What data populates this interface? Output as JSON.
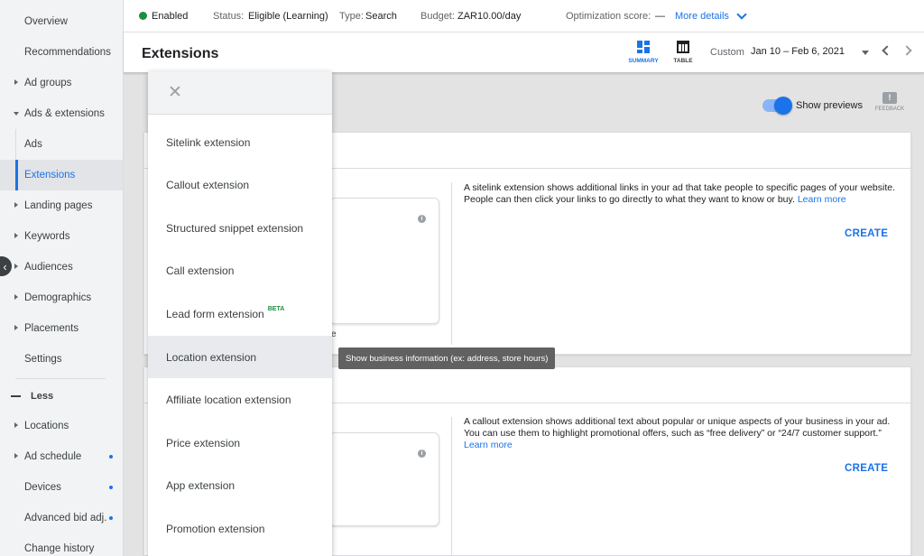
{
  "sidebar": {
    "items": [
      {
        "label": "Overview"
      },
      {
        "label": "Recommendations"
      },
      {
        "label": "Ad groups"
      },
      {
        "label": "Ads & extensions"
      },
      {
        "label": "Ads"
      },
      {
        "label": "Extensions"
      },
      {
        "label": "Landing pages"
      },
      {
        "label": "Keywords"
      },
      {
        "label": "Audiences"
      },
      {
        "label": "Demographics"
      },
      {
        "label": "Placements"
      },
      {
        "label": "Settings"
      },
      {
        "label": "Locations"
      },
      {
        "label": "Ad schedule"
      },
      {
        "label": "Devices"
      },
      {
        "label": "Advanced bid adj."
      },
      {
        "label": "Change history"
      }
    ],
    "less_label": "Less",
    "collapse_glyph": "‹"
  },
  "status_bar": {
    "enabled": "Enabled",
    "status_label": "Status:",
    "status_value": "Eligible (Learning)",
    "type_label": "Type:",
    "type_value": "Search",
    "budget_label": "Budget:",
    "budget_value": "ZAR10.00/day",
    "optimization_label": "Optimization score:",
    "optimization_value": "—",
    "more_details": "More details",
    "enabled_color": "#1e8e3e"
  },
  "header": {
    "title": "Extensions",
    "summary_label": "SUMMARY",
    "table_label": "TABLE",
    "custom_label": "Custom",
    "date_range": "Jan 10 – Feb 6, 2021"
  },
  "main": {
    "show_previews": "Show previews",
    "feedback_label": "FEEDBACK",
    "feedback_glyph": "!",
    "stray_text": "e",
    "cards": [
      {
        "description": "A sitelink extension shows additional links in your ad that take people to specific pages of your website. People can then click your links to go directly to what they want to know or buy.",
        "learn_more": "Learn more",
        "create": "CREATE"
      },
      {
        "description": "A callout extension shows additional text about popular or unique aspects of your business in your ad. You can use them to highlight promotional offers, such as “free delivery” or “24/7 customer support.”",
        "learn_more": "Learn more",
        "create": "CREATE"
      }
    ]
  },
  "menu": {
    "close_glyph": "✕",
    "items": [
      {
        "label": "Sitelink extension"
      },
      {
        "label": "Callout extension"
      },
      {
        "label": "Structured snippet extension"
      },
      {
        "label": "Call extension"
      },
      {
        "label": "Lead form extension",
        "badge": "BETA"
      },
      {
        "label": "Location extension"
      },
      {
        "label": "Affiliate location extension"
      },
      {
        "label": "Price extension"
      },
      {
        "label": "App extension"
      },
      {
        "label": "Promotion extension"
      }
    ]
  },
  "tooltip": "Show business information (ex: address, store hours)",
  "colors": {
    "accent": "#1a73e8",
    "beta": "#1e8e3e"
  }
}
